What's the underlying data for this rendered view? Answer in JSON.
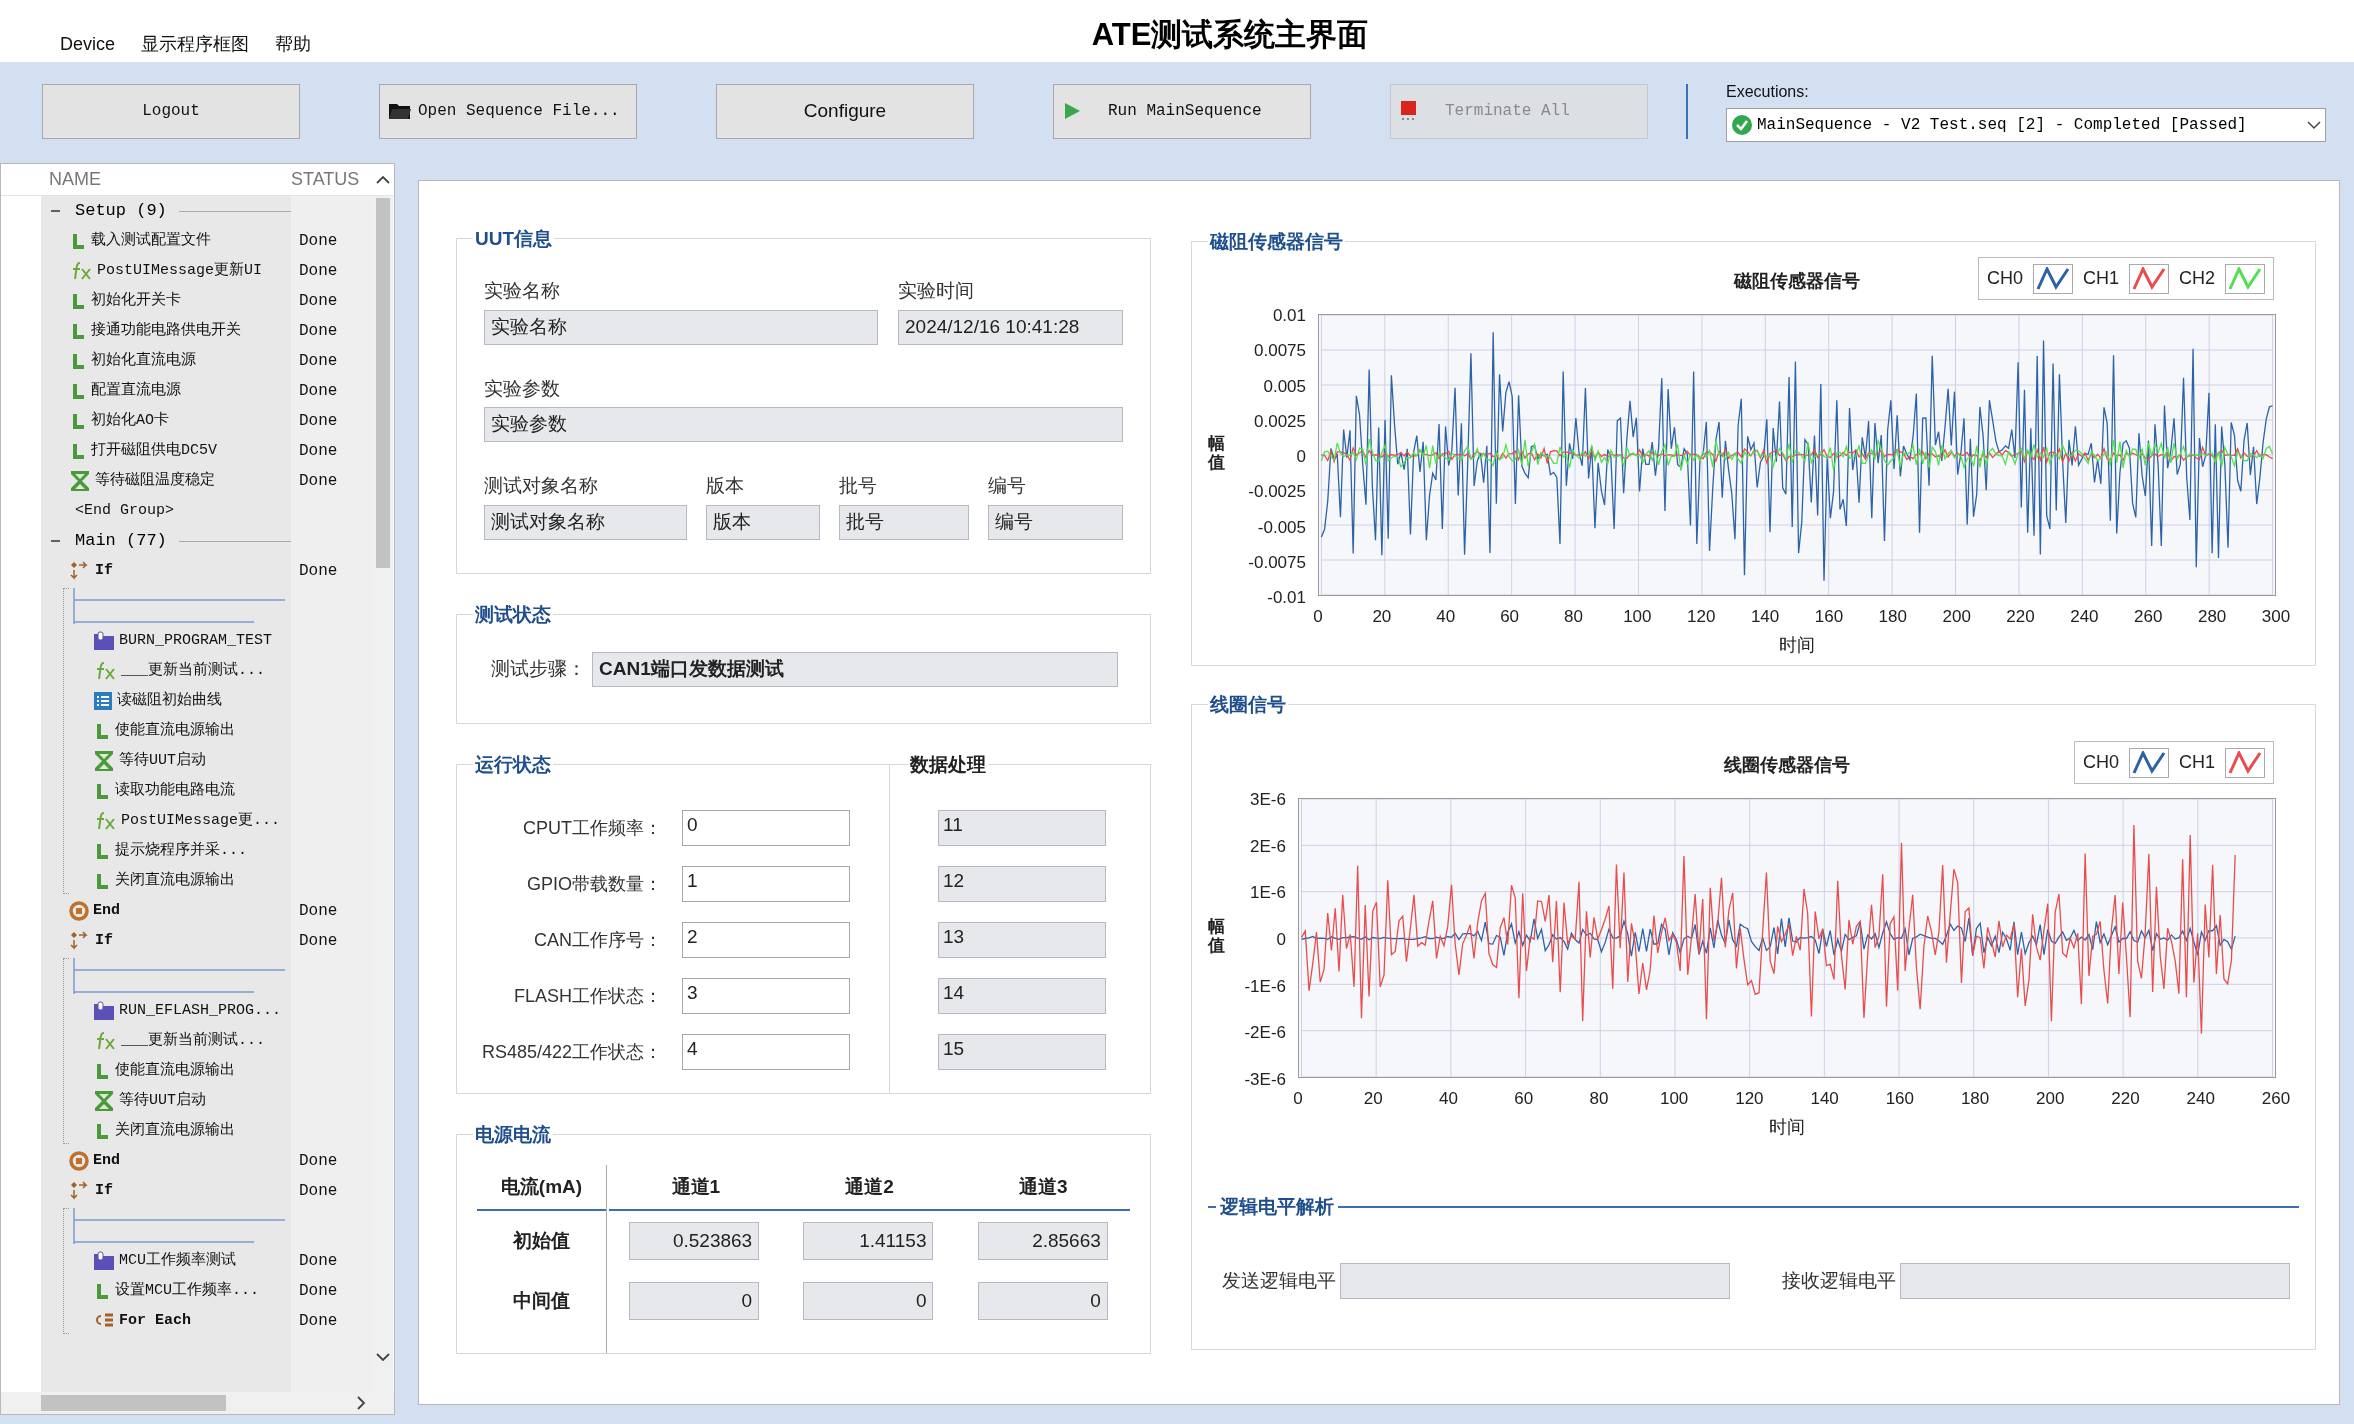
{
  "window": {
    "title": "ATE测试系统主界面"
  },
  "menu": [
    "Device",
    "显示程序框图",
    "帮助"
  ],
  "toolbar": [
    {
      "label": "Logout",
      "kind": "mono",
      "disabled": false
    },
    {
      "label": "Open Sequence File...",
      "kind": "open",
      "disabled": false
    },
    {
      "label": "Configure",
      "kind": "sans",
      "disabled": false
    },
    {
      "label": "Run MainSequence",
      "kind": "run",
      "disabled": false
    },
    {
      "label": "Terminate All",
      "kind": "stop",
      "disabled": true
    }
  ],
  "executions": {
    "label": "Executions:",
    "value": "MainSequence - V2 Test.seq [2] - Completed [Passed]"
  },
  "tree": {
    "columns": [
      "NAME",
      "STATUS"
    ],
    "items": [
      {
        "kind": "group",
        "label": "Setup (9)",
        "expanded": true,
        "children": [
          {
            "kind": "labview",
            "label": "载入测试配置文件",
            "status": "Done"
          },
          {
            "kind": "fx",
            "label": "PostUIMessage更新UI",
            "status": "Done"
          },
          {
            "kind": "labview",
            "label": "初始化开关卡",
            "status": "Done"
          },
          {
            "kind": "labview",
            "label": "接通功能电路供电开关",
            "status": "Done"
          },
          {
            "kind": "labview",
            "label": "初始化直流电源",
            "status": "Done"
          },
          {
            "kind": "labview",
            "label": "配置直流电源",
            "status": "Done"
          },
          {
            "kind": "labview",
            "label": "初始化AO卡",
            "status": "Done"
          },
          {
            "kind": "labview",
            "label": "打开磁阻供电DC5V",
            "status": "Done"
          },
          {
            "kind": "wait",
            "label": "等待磁阻温度稳定",
            "status": "Done"
          }
        ]
      },
      {
        "kind": "end_group",
        "label": "<End Group>"
      },
      {
        "kind": "group",
        "label": "Main (77)",
        "expanded": true,
        "children": [
          {
            "kind": "if",
            "label": "If",
            "status": "Done",
            "children": [
              {
                "kind": "sequence_call",
                "label": "BURN_PROGRAM_TEST"
              },
              {
                "kind": "fx",
                "label": "___更新当前测试..."
              },
              {
                "kind": "table",
                "label": "读磁阻初始曲线"
              },
              {
                "kind": "labview",
                "label": "使能直流电源输出"
              },
              {
                "kind": "wait",
                "label": "等待UUT启动"
              },
              {
                "kind": "labview",
                "label": "读取功能电路电流"
              },
              {
                "kind": "fx",
                "label": "PostUIMessage更..."
              },
              {
                "kind": "labview",
                "label": "提示烧程序并采..."
              },
              {
                "kind": "labview",
                "label": "关闭直流电源输出"
              }
            ]
          },
          {
            "kind": "end",
            "label": "End",
            "status": "Done"
          },
          {
            "kind": "if",
            "label": "If",
            "status": "Done",
            "children": [
              {
                "kind": "sequence_call",
                "label": "RUN_EFLASH_PROG..."
              },
              {
                "kind": "fx",
                "label": "___更新当前测试..."
              },
              {
                "kind": "labview",
                "label": "使能直流电源输出"
              },
              {
                "kind": "wait",
                "label": "等待UUT启动"
              },
              {
                "kind": "labview",
                "label": "关闭直流电源输出"
              }
            ]
          },
          {
            "kind": "end",
            "label": "End",
            "status": "Done"
          },
          {
            "kind": "if",
            "label": "If",
            "status": "Done",
            "children": [
              {
                "kind": "sequence_call",
                "label": "MCU工作频率测试",
                "status": "Done"
              },
              {
                "kind": "labview",
                "label": "设置MCU工作频率...",
                "status": "Done"
              },
              {
                "kind": "for_each",
                "label": "For Each",
                "status": "Done"
              }
            ]
          }
        ]
      }
    ]
  },
  "uut": {
    "title": "UUT信息",
    "fields": [
      {
        "label": "实验名称",
        "value": "实验名称"
      },
      {
        "label": "实验时间",
        "value": "2024/12/16 10:41:28"
      },
      {
        "label": "实验参数",
        "value": "实验参数"
      },
      {
        "label": "测试对象名称",
        "value": "测试对象名称"
      },
      {
        "label": "版本",
        "value": "版本"
      },
      {
        "label": "批号",
        "value": "批号"
      },
      {
        "label": "编号",
        "value": "编号"
      }
    ]
  },
  "test_status": {
    "title": "测试状态",
    "label": "测试步骤：",
    "value": "CAN1端口发数据测试"
  },
  "run_status": {
    "title": "运行状态",
    "rows": [
      {
        "label": "CPUT工作频率：",
        "value": "0"
      },
      {
        "label": "GPIO带载数量：",
        "value": "1"
      },
      {
        "label": "CAN工作序号：",
        "value": "2"
      },
      {
        "label": "FLASH工作状态：",
        "value": "3"
      },
      {
        "label": "RS485/422工作状态：",
        "value": "4"
      }
    ]
  },
  "data_processing": {
    "title": "数据处理",
    "values": [
      "11",
      "12",
      "13",
      "14",
      "15"
    ]
  },
  "power_current": {
    "title": "电源电流",
    "columns": [
      "电流(mA)",
      "通道1",
      "通道2",
      "通道3"
    ],
    "rows": [
      {
        "label": "初始值",
        "values": [
          "0.523863",
          "1.41153",
          "2.85663"
        ]
      },
      {
        "label": "中间值",
        "values": [
          "0",
          "0",
          "0"
        ]
      }
    ]
  },
  "charts": [
    {
      "group": "磁阻传感器信号",
      "title": "磁阻传感器信号",
      "ylabel": "幅值",
      "xlabel": "时间",
      "legend": [
        {
          "name": "CH0",
          "color": "#2b62a8"
        },
        {
          "name": "CH1",
          "color": "#e84c4c"
        },
        {
          "name": "CH2",
          "color": "#52e052"
        }
      ],
      "yticks": [
        "0.01",
        "0.0075",
        "0.005",
        "0.0025",
        "0",
        "-0.0025",
        "-0.005",
        "-0.0075",
        "-0.01"
      ],
      "xticks": [
        "0",
        "20",
        "40",
        "60",
        "80",
        "100",
        "120",
        "140",
        "160",
        "180",
        "200",
        "220",
        "240",
        "260",
        "280",
        "300"
      ]
    },
    {
      "group": "线圈信号",
      "title": "线圈传感器信号",
      "ylabel": "幅值",
      "xlabel": "时间",
      "legend": [
        {
          "name": "CH0",
          "color": "#2b62a8"
        },
        {
          "name": "CH1",
          "color": "#e84c4c"
        }
      ],
      "yticks": [
        "3E-6",
        "2E-6",
        "1E-6",
        "0",
        "-1E-6",
        "-2E-6",
        "-3E-6"
      ],
      "xticks": [
        "0",
        "20",
        "40",
        "60",
        "80",
        "100",
        "120",
        "140",
        "160",
        "180",
        "200",
        "220",
        "240",
        "260"
      ]
    }
  ],
  "logic": {
    "title": "逻辑电平解析",
    "fields": [
      {
        "label": "发送逻辑电平"
      },
      {
        "label": "接收逻辑电平"
      }
    ]
  }
}
